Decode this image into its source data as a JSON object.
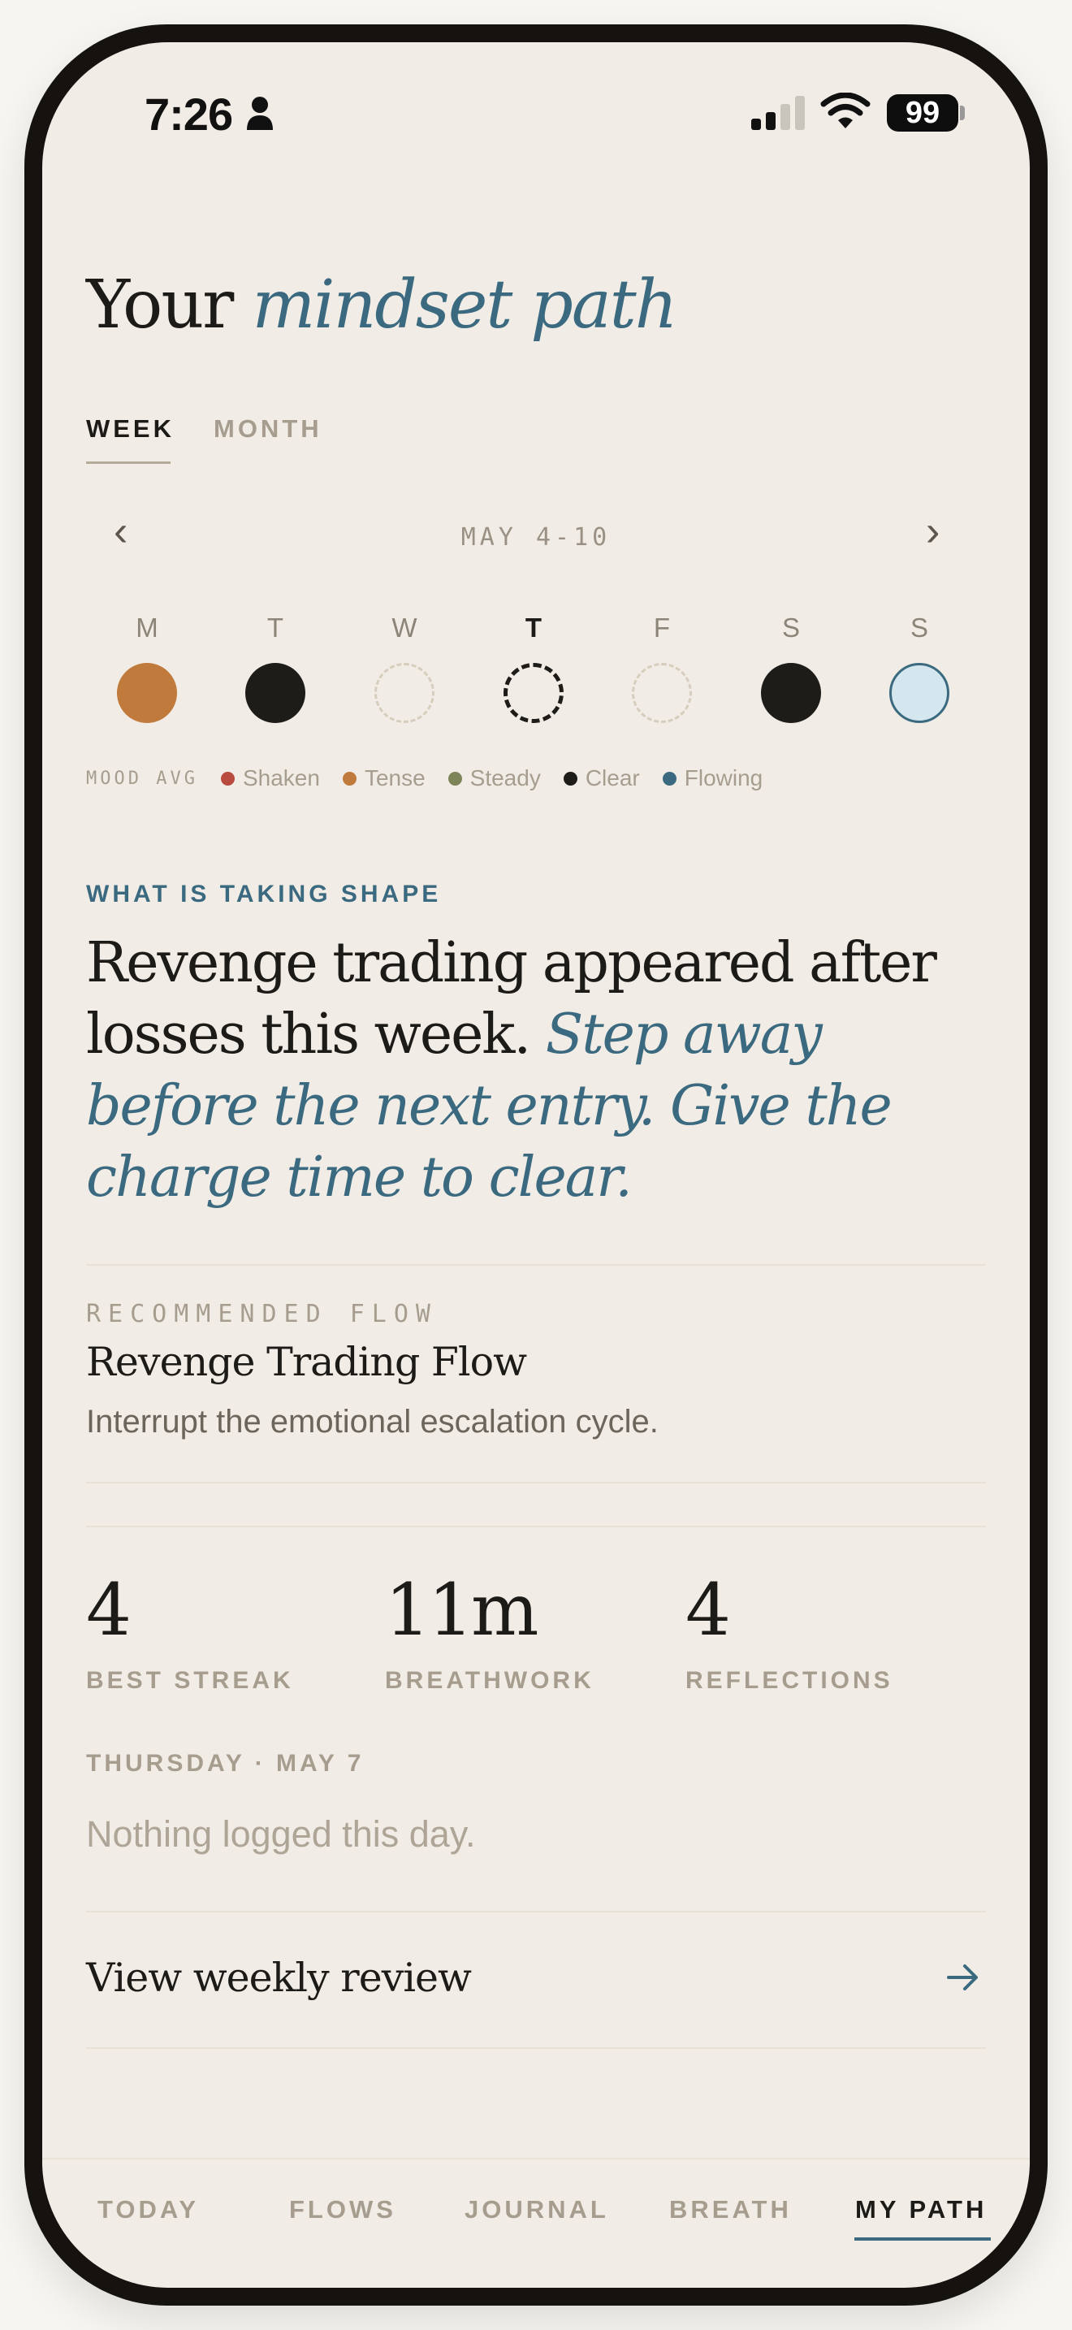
{
  "status_bar": {
    "time": "7:26",
    "battery": "99",
    "icons": [
      "person-icon",
      "signal-icon",
      "wifi-icon",
      "battery-icon"
    ]
  },
  "header": {
    "title_plain": "Your",
    "title_accent": "mindset path"
  },
  "tabs": {
    "week": "WEEK",
    "month": "MONTH",
    "active": "WEEK"
  },
  "week_nav": {
    "prev": "‹",
    "next": "›",
    "range": "MAY 4-10"
  },
  "days": [
    {
      "label": "M",
      "mood": "Tense"
    },
    {
      "label": "T",
      "mood": "Clear"
    },
    {
      "label": "W",
      "mood": null
    },
    {
      "label": "T",
      "mood": null,
      "selected": true
    },
    {
      "label": "F",
      "mood": null
    },
    {
      "label": "S",
      "mood": "Clear"
    },
    {
      "label": "S",
      "mood": "Flowing"
    }
  ],
  "legend": {
    "title": "MOOD AVG",
    "items": [
      {
        "label": "Shaken",
        "color": "#b94a3e"
      },
      {
        "label": "Tense",
        "color": "#c07a3b"
      },
      {
        "label": "Steady",
        "color": "#7d8457"
      },
      {
        "label": "Clear",
        "color": "#1e1c19"
      },
      {
        "label": "Flowing",
        "color": "#3b6a80"
      }
    ]
  },
  "insight": {
    "label": "WHAT IS TAKING SHAPE",
    "text_plain": "Revenge trading appeared after losses this week.",
    "text_accent": "Step away before the next entry. Give the charge time to clear."
  },
  "recommended_flow": {
    "label": "RECOMMENDED FLOW",
    "title": "Revenge Trading Flow",
    "description": "Interrupt the emotional escalation cycle."
  },
  "stats": [
    {
      "value": "4",
      "label": "BEST STREAK"
    },
    {
      "value": "11m",
      "label": "BREATHWORK"
    },
    {
      "value": "4",
      "label": "REFLECTIONS"
    }
  ],
  "day_detail": {
    "heading": "THURSDAY · MAY 7",
    "empty_text": "Nothing logged this day."
  },
  "weekly_review": {
    "label": "View weekly review"
  },
  "bottom_nav": {
    "items": [
      "TODAY",
      "FLOWS",
      "JOURNAL",
      "BREATH",
      "MY PATH"
    ],
    "active": "MY PATH"
  },
  "colors": {
    "background": "#f1ede6",
    "accent": "#3b6a80",
    "text": "#1d1b18",
    "muted": "#a79d8f"
  }
}
